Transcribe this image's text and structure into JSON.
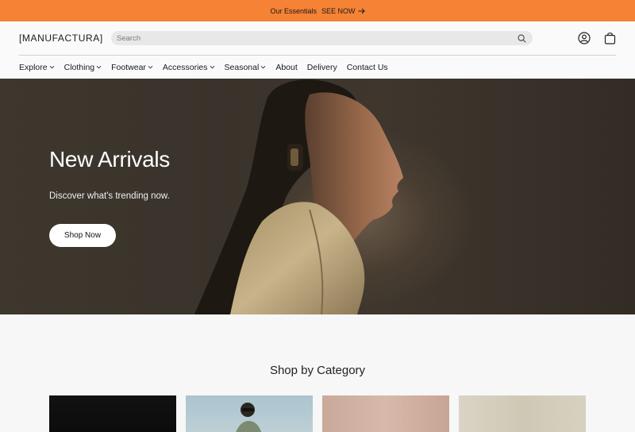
{
  "announcement": {
    "message": "Our Essentials",
    "cta": "SEE NOW"
  },
  "header": {
    "logo": "[MANUFACTURA]",
    "search_placeholder": "Search",
    "icons": [
      "account-icon",
      "bag-icon"
    ]
  },
  "nav": {
    "items": [
      {
        "label": "Explore",
        "dropdown": true
      },
      {
        "label": "Clothing",
        "dropdown": true
      },
      {
        "label": "Footwear",
        "dropdown": true
      },
      {
        "label": "Accessories",
        "dropdown": true
      },
      {
        "label": "Seasonal",
        "dropdown": true
      },
      {
        "label": "About",
        "dropdown": false
      },
      {
        "label": "Delivery",
        "dropdown": false
      },
      {
        "label": "Contact Us",
        "dropdown": false
      }
    ]
  },
  "hero": {
    "title": "New Arrivals",
    "subtitle": "Discover what's trending now.",
    "button": "Shop Now"
  },
  "categories": {
    "title": "Shop by Category"
  },
  "colors": {
    "announcement_bg": "#f58235",
    "hero_text": "#ffffff"
  }
}
